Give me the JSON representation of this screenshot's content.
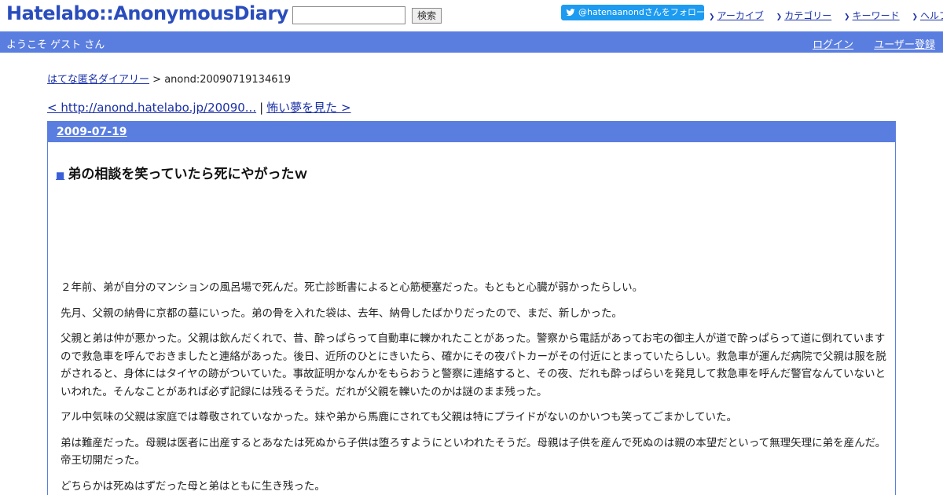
{
  "header": {
    "logo": "Hatelabo::AnonymousDiary",
    "search_button": "検索",
    "search_value": "",
    "follow_button": "@hatenaanondさんをフォロー",
    "links": [
      "アーカイブ",
      "カテゴリー",
      "キーワード",
      "ヘルプ"
    ]
  },
  "welcome": {
    "text": "ようこそ ゲスト さん",
    "login": "ログイン",
    "register": "ユーザー登録"
  },
  "breadcrumb": {
    "home": "はてな匿名ダイアリー",
    "separator": ">",
    "current": "anond:20090719134619"
  },
  "nav": {
    "prev": "< http://anond.hatelabo.jp/20090...",
    "separator": "|",
    "next": "怖い夢を見た >"
  },
  "entry": {
    "date": "2009-07-19",
    "bullet": "■",
    "title": "弟の相談を笑っていたら死にやがったｗ",
    "paragraphs": [
      "２年前、弟が自分のマンションの風呂場で死んだ。死亡診断書によると心筋梗塞だった。もともと心臓が弱かったらしい。",
      "先月、父親の納骨に京都の墓にいった。弟の骨を入れた袋は、去年、納骨したばかりだったので、まだ、新しかった。",
      "父親と弟は仲が悪かった。父親は飲んだくれで、昔、酔っぱらって自動車に轢かれたことがあった。警察から電話があってお宅の御主人が道で酔っぱらって道に倒れていますので救急車を呼んでおきましたと連絡があった。後日、近所のひとにきいたら、確かにその夜パトカーがその付近にとまっていたらしい。救急車が運んだ病院で父親は服を脱がされると、身体にはタイヤの跡がついていた。事故証明かなんかをもらおうと警察に連絡すると、その夜、だれも酔っぱらいを発見して救急車を呼んだ警官なんていないといわれた。そんなことがあれば必ず記録には残るそうだ。だれが父親を轢いたのかは謎のまま残った。",
      "アル中気味の父親は家庭では尊敬されていなかった。妹や弟から馬鹿にされても父親は特にプライドがないのかいつも笑ってごまかしていた。",
      "弟は難産だった。母親は医者に出産するとあなたは死ぬから子供は堕ろすようにといわれたそうだ。母親は子供を産んで死ぬのは親の本望だといって無理矢理に弟を産んだ。帝王切開だった。",
      "どちらかは死ぬはずだった母と弟はともに生き残った。"
    ]
  },
  "colors": {
    "brand_blue": "#5a7ee0",
    "logo_blue": "#2a4dbd",
    "link": "#1a30a8",
    "twitter": "#1d9bf0"
  }
}
